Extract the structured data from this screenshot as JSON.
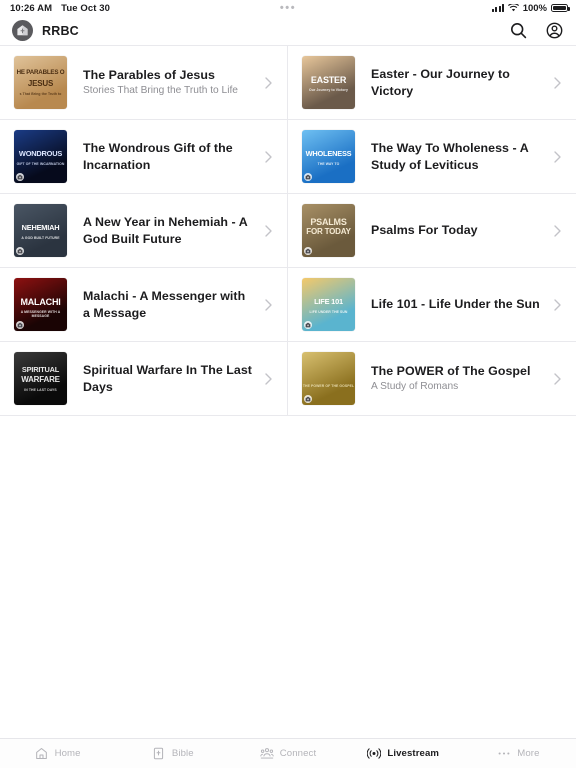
{
  "status_bar": {
    "time": "10:26 AM",
    "date": "Tue Oct 30",
    "center_indicator": "•••",
    "battery_percent": "100%",
    "signal_icon": "cellular-bars-icon",
    "wifi_icon": "wifi-icon",
    "battery_icon": "battery-full-icon"
  },
  "header": {
    "brand_name": "RRBC",
    "logo_icon": "rrbc-logo-icon",
    "search_icon": "search-icon",
    "account_icon": "account-circle-icon"
  },
  "list": {
    "chevron_icon": "chevron-right-icon",
    "items": [
      {
        "title": "The Parables of Jesus",
        "subtitle": "Stories That Bring the Truth to Life",
        "thumb_text": "he Parables o",
        "thumb_text2": "Jesus",
        "thumb_sub": "s That Bring the Truth to",
        "thumb_bg": "#b8894f",
        "thumb_bg2": "#e0c39a",
        "thumb_fg": "#4a2d11",
        "has_badge": false
      },
      {
        "title": "Easter - Our Journey to Victory",
        "subtitle": "",
        "thumb_text": "EASTER",
        "thumb_text2": "",
        "thumb_sub": "Our Journey to Victory",
        "thumb_bg": "#6b5a4a",
        "thumb_bg2": "#e8c79b",
        "thumb_fg": "#ffffff",
        "has_badge": false
      },
      {
        "title": "The Wondrous Gift of the Incarnation",
        "subtitle": "",
        "thumb_text": "Wondrous",
        "thumb_text2": "",
        "thumb_sub": "GIFT OF THE INCARNATION",
        "thumb_bg": "#060a1c",
        "thumb_bg2": "#1b3c86",
        "thumb_fg": "#dce6ff",
        "has_badge": true
      },
      {
        "title": "The Way To Wholeness - A Study of Leviticus",
        "subtitle": "",
        "thumb_text": "WHOLENESS",
        "thumb_text2": "",
        "thumb_sub": "THE WAY TO",
        "thumb_bg": "#1a6fc4",
        "thumb_bg2": "#6fc0f2",
        "thumb_fg": "#ffffff",
        "has_badge": true
      },
      {
        "title": "A New Year in Nehemiah - A God Built Future",
        "subtitle": "",
        "thumb_text": "NEHEMIAH",
        "thumb_text2": "",
        "thumb_sub": "A GOD BUILT FUTURE",
        "thumb_bg": "#2b3440",
        "thumb_bg2": "#4a5664",
        "thumb_fg": "#ffffff",
        "has_badge": true
      },
      {
        "title": "Psalms For Today",
        "subtitle": "",
        "thumb_text": "Psalms",
        "thumb_text2": "For Today",
        "thumb_sub": "",
        "thumb_bg": "#6b5a3c",
        "thumb_bg2": "#a89066",
        "thumb_fg": "#f5ead3",
        "has_badge": true
      },
      {
        "title": "Malachi - A Messenger with a Message",
        "subtitle": "",
        "thumb_text": "MALACHI",
        "thumb_text2": "",
        "thumb_sub": "A MESSENGER WITH A MESSAGE",
        "thumb_bg": "#1a0404",
        "thumb_bg2": "#8e1111",
        "thumb_fg": "#ffffff",
        "has_badge": true
      },
      {
        "title": "Life 101 - Life Under the Sun",
        "subtitle": "",
        "thumb_text": "LIFE 101",
        "thumb_text2": "",
        "thumb_sub": "LIFE UNDER THE SUN",
        "thumb_bg": "#5ab4cf",
        "thumb_bg2": "#f5c96a",
        "thumb_fg": "#ffffff",
        "has_badge": true
      },
      {
        "title": "Spiritual Warfare In The Last Days",
        "subtitle": "",
        "thumb_text": "SPIRITUAL",
        "thumb_text2": "WARFARE",
        "thumb_sub": "IN THE LAST DAYS",
        "thumb_bg": "#0a0a0a",
        "thumb_bg2": "#3a3a3a",
        "thumb_fg": "#e8e8e8",
        "has_badge": false
      },
      {
        "title": "The POWER of The Gospel",
        "subtitle": "A Study of Romans",
        "thumb_text": "",
        "thumb_text2": "",
        "thumb_sub": "THE POWER OF THE GOSPEL",
        "thumb_bg": "#8a6f1e",
        "thumb_bg2": "#d8c070",
        "thumb_fg": "#f2e8c0",
        "has_badge": true
      }
    ]
  },
  "tabbar": {
    "tabs": [
      {
        "label": "Home",
        "icon": "home-icon",
        "active": false
      },
      {
        "label": "Bible",
        "icon": "bible-book-icon",
        "active": false
      },
      {
        "label": "Connect",
        "icon": "people-group-icon",
        "active": false
      },
      {
        "label": "Livestream",
        "icon": "broadcast-icon",
        "active": true
      },
      {
        "label": "More",
        "icon": "ellipsis-icon",
        "active": false
      }
    ]
  },
  "colors": {
    "text_primary": "#1c1c1e",
    "text_secondary": "#8e8e93",
    "separator": "#e9e9ed",
    "chevron": "#c3c3c8",
    "tab_inactive": "#b4b4b9"
  }
}
